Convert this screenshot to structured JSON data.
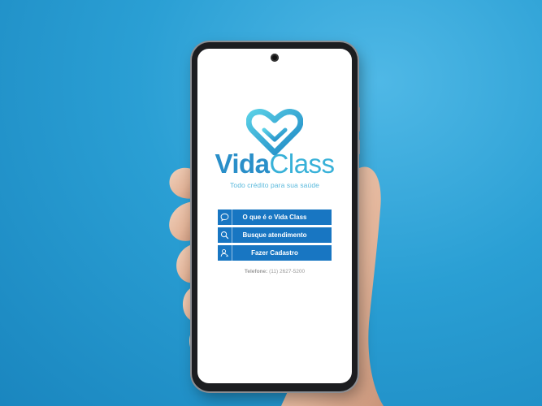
{
  "app": {
    "brand_vida": "Vida",
    "brand_class": "Class",
    "tagline": "Todo crédito para sua saúde"
  },
  "menu": {
    "items": [
      {
        "label": "O que é o Vida Class",
        "icon": "chat-bubble-icon"
      },
      {
        "label": "Busque atendimento",
        "icon": "search-icon"
      },
      {
        "label": "Fazer Cadastro",
        "icon": "user-register-icon"
      }
    ]
  },
  "contact": {
    "phone_label": "Telefone:",
    "phone_number": "(11) 2627-5200"
  },
  "colors": {
    "button_blue": "#1876c2",
    "brand_dark": "#2a8fc9",
    "brand_light": "#38b1d8",
    "background": "#2a9fd4"
  }
}
